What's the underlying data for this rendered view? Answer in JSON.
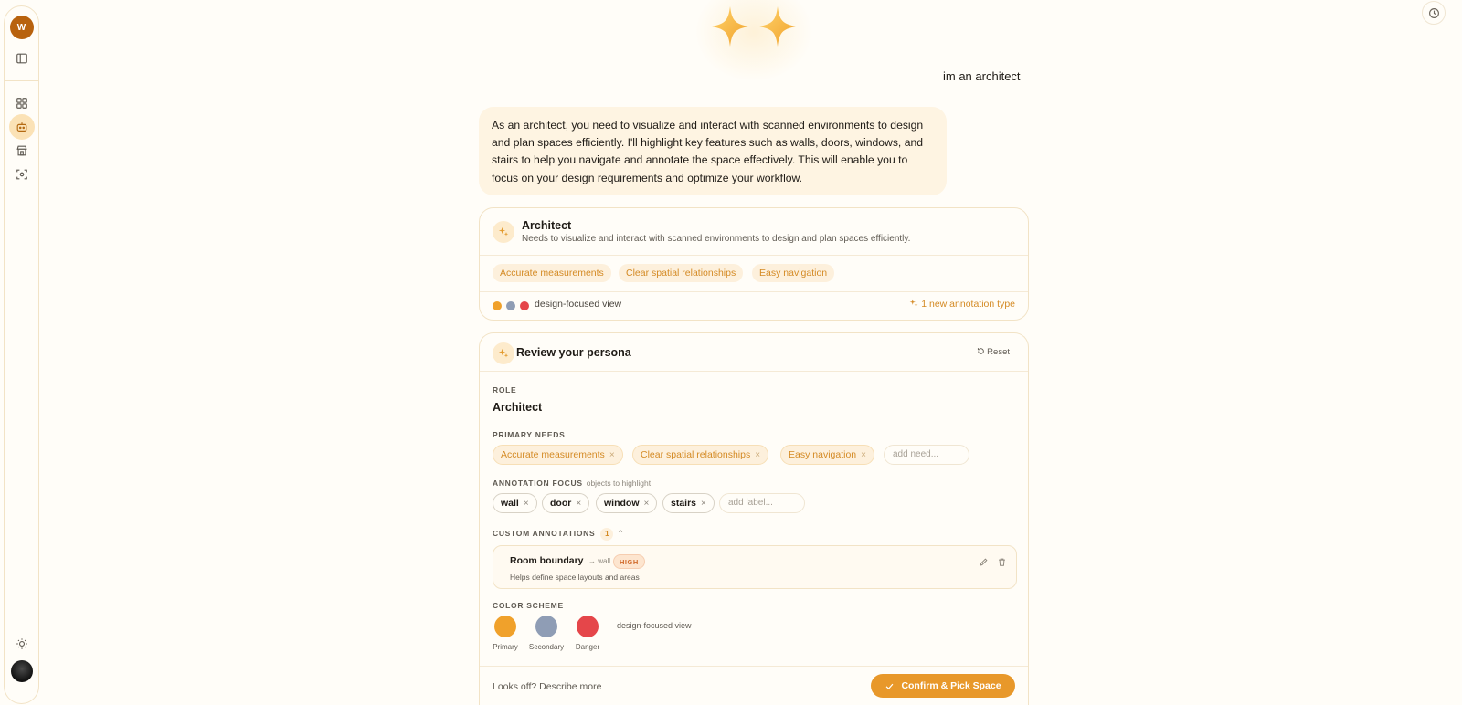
{
  "sidebar": {
    "workspace_initial": "W",
    "items": [
      {
        "icon": "panel-toggle-icon"
      },
      {
        "icon": "dashboard-grid-icon"
      },
      {
        "icon": "robot-icon",
        "active": true
      },
      {
        "icon": "store-icon"
      },
      {
        "icon": "scan-icon"
      }
    ],
    "bottom": [
      {
        "icon": "sun-icon"
      },
      {
        "icon": "user-avatar"
      }
    ]
  },
  "chat": {
    "user_message": "im an architect",
    "assistant_message": "As an architect, you need to visualize and interact with scanned environments to design and plan spaces efficiently. I'll highlight key features such as walls, doors, windows, and stairs to help you navigate and annotate the space effectively. This will enable you to focus on your design requirements and optimize your workflow."
  },
  "persona_card": {
    "title": "Architect",
    "description": "Needs to visualize and interact with scanned environments to design and plan spaces efficiently.",
    "needs": [
      "Accurate measurements",
      "Clear spatial relationships",
      "Easy navigation"
    ],
    "colors": [
      "#f0a12b",
      "#8f9db5",
      "#e5464a"
    ],
    "view_label": "design-focused view",
    "new_annotation_text": "1 new annotation type"
  },
  "review": {
    "title": "Review your persona",
    "reset_label": "Reset",
    "role_label": "ROLE",
    "role_value": "Architect",
    "needs_label": "PRIMARY NEEDS",
    "needs": [
      "Accurate measurements",
      "Clear spatial relationships",
      "Easy navigation"
    ],
    "needs_placeholder": "add need...",
    "focus_label": "ANNOTATION FOCUS",
    "focus_sub": "objects to highlight",
    "focus_items": [
      "wall",
      "door",
      "window",
      "stairs"
    ],
    "focus_placeholder": "add label...",
    "custom_label": "CUSTOM ANNOTATIONS",
    "custom_count": "1",
    "custom": [
      {
        "name": "Room boundary",
        "target": "→ wall",
        "priority": "HIGH",
        "description": "Helps define space layouts and areas"
      }
    ],
    "scheme_label": "COLOR SCHEME",
    "scheme": [
      {
        "name": "Primary",
        "color": "#f0a12b"
      },
      {
        "name": "Secondary",
        "color": "#8f9db5"
      },
      {
        "name": "Danger",
        "color": "#e5464a"
      }
    ],
    "scheme_name": "design-focused view",
    "looks_off": "Looks off? Describe more",
    "confirm_label": "Confirm & Pick Space"
  },
  "x": "×"
}
